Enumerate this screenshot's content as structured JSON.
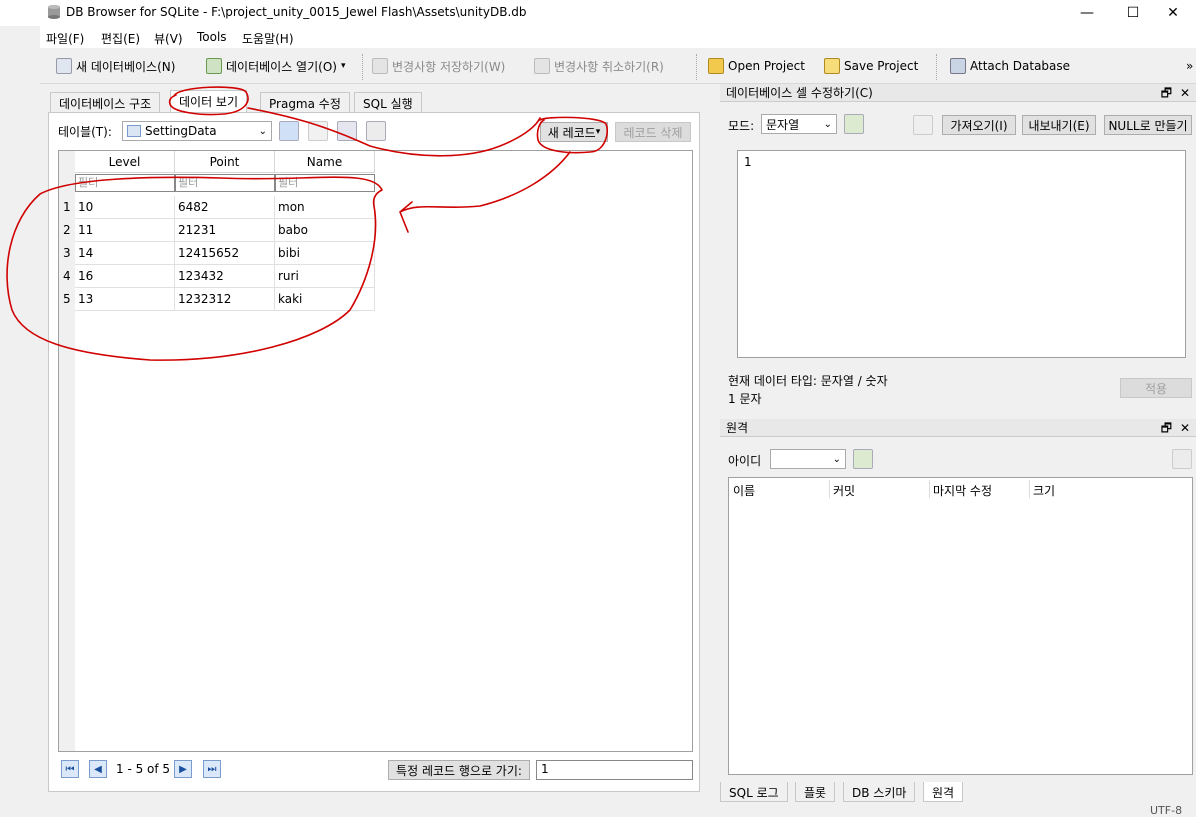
{
  "window": {
    "title": "DB Browser for SQLite - F:\\project_unity_0015_Jewel Flash\\Assets\\unityDB.db",
    "controls": {
      "minimize": "—",
      "maximize": "☐",
      "close": "✕"
    }
  },
  "menu": [
    "파일(F)",
    "편집(E)",
    "뷰(V)",
    "Tools",
    "도움말(H)"
  ],
  "toolbar": {
    "new_db": "새 데이터베이스(N)",
    "open_db": "데이터베이스 열기(O)",
    "write_changes": "변경사항 저장하기(W)",
    "revert_changes": "변경사항 취소하기(R)",
    "open_project": "Open Project",
    "save_project": "Save Project",
    "attach_db": "Attach Database",
    "overflow": "»"
  },
  "tabs": [
    "데이터베이스 구조",
    "데이터 보기",
    "Pragma 수정",
    "SQL 실행"
  ],
  "browse": {
    "table_label": "테이블(T):",
    "table_selected": "SettingData",
    "new_record": "새 레코드",
    "delete_record": "레코드 삭제",
    "columns": [
      "Level",
      "Point",
      "Name"
    ],
    "filter_placeholder": "필터",
    "rows": [
      [
        "10",
        "6482",
        "mon"
      ],
      [
        "11",
        "21231",
        "babo"
      ],
      [
        "14",
        "12415652",
        "bibi"
      ],
      [
        "16",
        "123432",
        "ruri"
      ],
      [
        "13",
        "1232312",
        "kaki"
      ]
    ],
    "row_numbers": [
      "1",
      "2",
      "3",
      "4",
      "5"
    ],
    "pager_text": "1 - 5 of 5",
    "goto_label": "특정 레코드 행으로 가기:",
    "goto_value": "1"
  },
  "edit_cell": {
    "title": "데이터베이스 셀 수정하기(C)",
    "mode_label": "모드:",
    "mode_value": "문자열",
    "import": "가져오기(I)",
    "export": "내보내기(E)",
    "set_null": "NULL로 만들기",
    "content": "1",
    "type_info": "현재 데이터 타입: 문자열 / 숫자",
    "size_info": "1 문자",
    "apply": "적용"
  },
  "remote": {
    "title": "원격",
    "identity_label": "아이디",
    "columns": [
      "이름",
      "커밋",
      "마지막 수정",
      "크기"
    ]
  },
  "bottom_tabs": [
    "SQL 로그",
    "플롯",
    "DB 스키마",
    "원격"
  ],
  "status": {
    "encoding": "UTF-8"
  },
  "dock_icons": {
    "float": "🗗",
    "close": "✕"
  }
}
